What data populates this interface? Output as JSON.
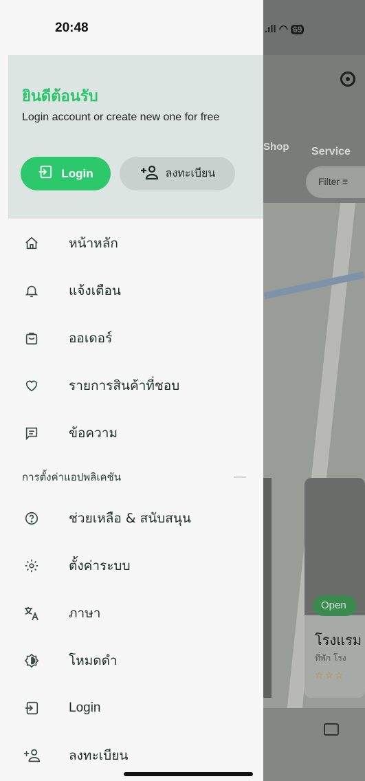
{
  "status": {
    "time": "20:48",
    "battery": "69"
  },
  "drawer": {
    "welcome": {
      "title": "ยินดีต้อนรับ",
      "subtitle": "Login account or create new one for free",
      "login_button": "Login",
      "register_button": "ลงทะเบียน"
    },
    "menu": [
      {
        "icon": "home-icon",
        "label": "หน้าหลัก"
      },
      {
        "icon": "bell-icon",
        "label": "แจ้งเตือน"
      },
      {
        "icon": "bag-icon",
        "label": "ออเดอร์"
      },
      {
        "icon": "heart-icon",
        "label": "รายการสินค้าที่ชอบ"
      },
      {
        "icon": "message-icon",
        "label": "ข้อความ"
      }
    ],
    "section_title": "การตั้งค่าแอปพลิเคชัน",
    "settings_menu": [
      {
        "icon": "help-icon",
        "label": "ช่วยเหลือ & สนับสนุน"
      },
      {
        "icon": "gear-icon",
        "label": "ตั้งค่าระบบ"
      },
      {
        "icon": "translate-icon",
        "label": "ภาษา"
      },
      {
        "icon": "dark-mode-icon",
        "label": "โหมดดำ"
      },
      {
        "icon": "login-icon",
        "label": "Login"
      },
      {
        "icon": "add-user-icon",
        "label": "ลงทะเบียน"
      }
    ]
  },
  "background": {
    "tabs": [
      "Shop",
      "Service"
    ],
    "filter_label": "Filter",
    "card_status": "Open",
    "card_title": "โรงแรม",
    "card_subtitle": "ที่พัก โรง",
    "stars": "☆☆☆"
  }
}
